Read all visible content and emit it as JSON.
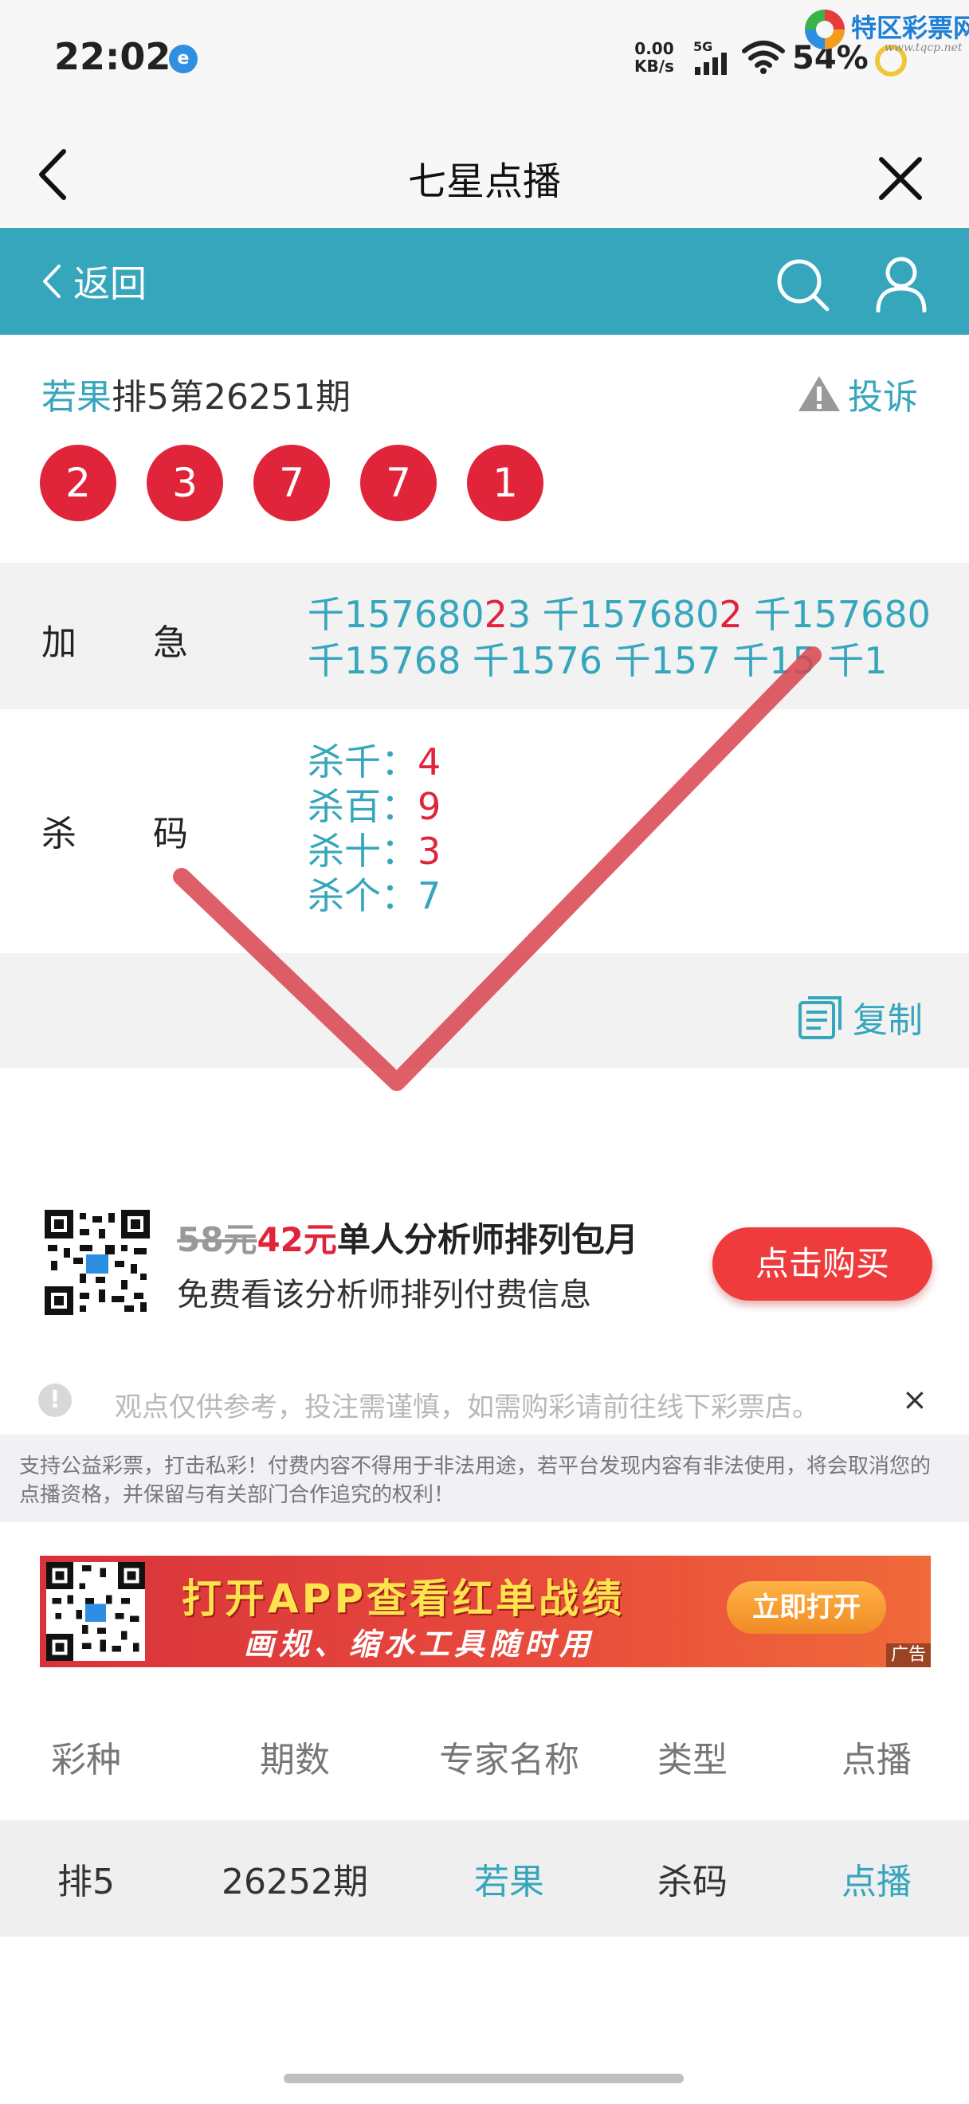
{
  "status_bar": {
    "time": "22:02",
    "net_speed_value": "0.00",
    "net_speed_unit": "KB/s",
    "network": "5G",
    "battery": "54%",
    "app_icon": "app-notification-icon"
  },
  "watermark": {
    "name": "特区彩票网",
    "url": "www.tqcp.net"
  },
  "title_bar": {
    "title": "七星点播"
  },
  "nav": {
    "back_label": "返回"
  },
  "header": {
    "expert": "若果",
    "issue": "排5第26251期",
    "complain_label": "投诉",
    "balls": [
      "2",
      "3",
      "7",
      "7",
      "1"
    ]
  },
  "jiaji": {
    "label": "加急",
    "line1": [
      {
        "text": "千157680"
      },
      {
        "text": "2",
        "red": true
      },
      {
        "text": "3"
      },
      {
        "text": " 千157680"
      },
      {
        "text": "2",
        "red": true
      },
      {
        "text": " 千157680"
      }
    ],
    "line2": "千15768 千1576 千157 千15 千1"
  },
  "shama": {
    "label": "杀码",
    "items": [
      {
        "label": "杀千：",
        "value": "4",
        "red": true
      },
      {
        "label": "杀百：",
        "value": "9",
        "red": true
      },
      {
        "label": "杀十：",
        "value": "3",
        "red": true
      },
      {
        "label": "杀个：",
        "value": "7",
        "red": false
      }
    ]
  },
  "copy_label": "复制",
  "promo": {
    "old_price": "58元",
    "new_price": "42元",
    "title": "单人分析师排列包月",
    "subtitle": "免费看该分析师排列付费信息",
    "buy_button": "点击购买"
  },
  "notice": {
    "text": "观点仅供参考，投注需谨慎，如需购彩请前往线下彩票店。",
    "close": "×"
  },
  "disclaimer": "支持公益彩票，打击私彩！付费内容不得用于非法用途，若平台发现内容有非法使用，将会取消您的点播资格，并保留与有关部门合作追究的权利！",
  "banner": {
    "main": "打开APP查看红单战绩",
    "sub": "画规、缩水工具随时用",
    "open_button": "立即打开",
    "ad_tag": "广告"
  },
  "table": {
    "headers": [
      "彩种",
      "期数",
      "专家名称",
      "类型",
      "点播"
    ],
    "rows": [
      {
        "lottery": "排5",
        "period": "26252期",
        "expert": "若果",
        "type": "杀码",
        "action": "点播"
      }
    ]
  },
  "colors": {
    "teal": "#36a6bd",
    "red": "#e0243a",
    "check": "#d9434f"
  }
}
